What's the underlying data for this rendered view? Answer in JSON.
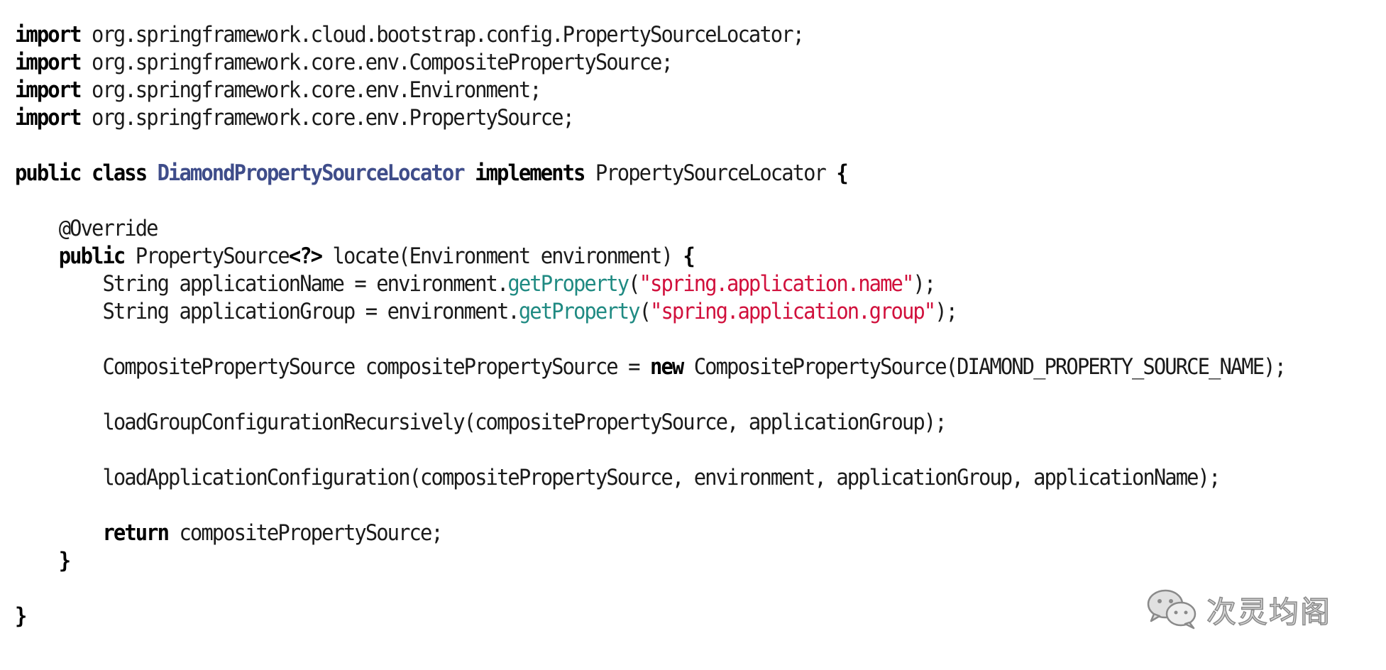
{
  "code_lines": [
    [
      {
        "t": "import",
        "c": "kw"
      },
      {
        "t": " org.springframework.cloud.bootstrap.config.PropertySourceLocator;",
        "c": ""
      }
    ],
    [
      {
        "t": "import",
        "c": "kw"
      },
      {
        "t": " org.springframework.core.env.CompositePropertySource;",
        "c": ""
      }
    ],
    [
      {
        "t": "import",
        "c": "kw"
      },
      {
        "t": " org.springframework.core.env.Environment;",
        "c": ""
      }
    ],
    [
      {
        "t": "import",
        "c": "kw"
      },
      {
        "t": " org.springframework.core.env.PropertySource;",
        "c": ""
      }
    ],
    [],
    [
      {
        "t": "public class",
        "c": "kw"
      },
      {
        "t": " ",
        "c": ""
      },
      {
        "t": "DiamondPropertySourceLocator",
        "c": "cls"
      },
      {
        "t": " ",
        "c": ""
      },
      {
        "t": "implements",
        "c": "kw"
      },
      {
        "t": " PropertySourceLocator ",
        "c": ""
      },
      {
        "t": "{",
        "c": "kw"
      }
    ],
    [],
    [
      {
        "t": "    @Override",
        "c": ""
      }
    ],
    [
      {
        "t": "    ",
        "c": ""
      },
      {
        "t": "public",
        "c": "kw"
      },
      {
        "t": " PropertySource",
        "c": ""
      },
      {
        "t": "<?>",
        "c": "kw"
      },
      {
        "t": " locate(Environment environment) ",
        "c": ""
      },
      {
        "t": "{",
        "c": "kw"
      }
    ],
    [
      {
        "t": "        String applicationName = environment.",
        "c": ""
      },
      {
        "t": "getProperty",
        "c": "mth"
      },
      {
        "t": "(",
        "c": ""
      },
      {
        "t": "\"spring.application.name\"",
        "c": "str"
      },
      {
        "t": ");",
        "c": ""
      }
    ],
    [
      {
        "t": "        String applicationGroup = environment.",
        "c": ""
      },
      {
        "t": "getProperty",
        "c": "mth"
      },
      {
        "t": "(",
        "c": ""
      },
      {
        "t": "\"spring.application.group\"",
        "c": "str"
      },
      {
        "t": ");",
        "c": ""
      }
    ],
    [],
    [
      {
        "t": "        CompositePropertySource compositePropertySource = ",
        "c": ""
      },
      {
        "t": "new",
        "c": "kw"
      },
      {
        "t": " CompositePropertySource(DIAMOND_PROPERTY_SOURCE_NAME);",
        "c": ""
      }
    ],
    [],
    [
      {
        "t": "        loadGroupConfigurationRecursively(compositePropertySource, applicationGroup);",
        "c": ""
      }
    ],
    [],
    [
      {
        "t": "        loadApplicationConfiguration(compositePropertySource, environment, applicationGroup, applicationName);",
        "c": ""
      }
    ],
    [],
    [
      {
        "t": "        ",
        "c": ""
      },
      {
        "t": "return",
        "c": "kw"
      },
      {
        "t": " compositePropertySource;",
        "c": ""
      }
    ],
    [
      {
        "t": "    ",
        "c": ""
      },
      {
        "t": "}",
        "c": "kw"
      }
    ],
    [],
    [
      {
        "t": "}",
        "c": "kw"
      }
    ]
  ],
  "watermark": {
    "text": "次灵均阁",
    "icon": "wechat-icon"
  }
}
